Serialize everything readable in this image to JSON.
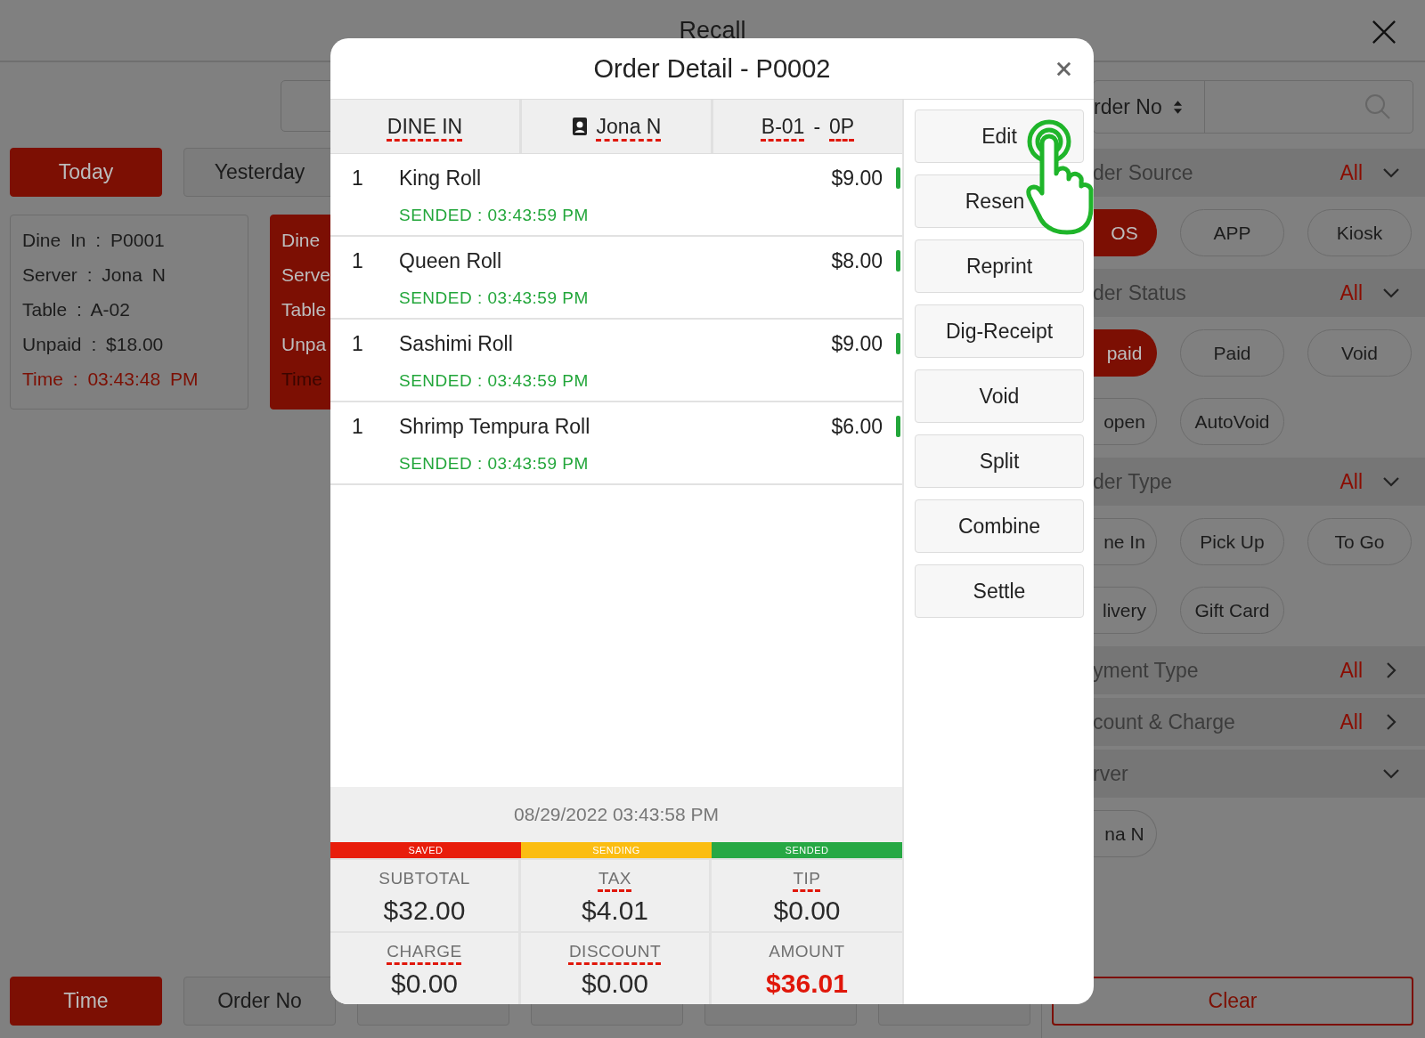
{
  "header": {
    "title": "Recall"
  },
  "date_filters": [
    {
      "label": "Today",
      "selected": true
    },
    {
      "label": "Yesterday",
      "selected": false
    }
  ],
  "orders": [
    {
      "selected": false,
      "lines": [
        {
          "text": "Dine In : P0001",
          "highlight": false
        },
        {
          "text": "Server : Jona N",
          "highlight": false
        },
        {
          "text": "Table : A-02",
          "highlight": false
        },
        {
          "text": "Unpaid : $18.00",
          "highlight": false
        },
        {
          "text": "Time : 03:43:48 PM",
          "highlight": true
        }
      ]
    },
    {
      "selected": true,
      "lines": [
        {
          "text": "Dine",
          "highlight": false
        },
        {
          "text": "Serve",
          "highlight": false
        },
        {
          "text": "Table",
          "highlight": false
        },
        {
          "text": "Unpa",
          "highlight": false
        },
        {
          "text": "Time",
          "highlight": true
        }
      ]
    }
  ],
  "sort_buttons": [
    {
      "label": "Time",
      "selected": true
    },
    {
      "label": "Order No",
      "selected": false
    },
    {
      "selected": false
    },
    {
      "selected": false
    },
    {
      "selected": false
    },
    {
      "selected": false
    }
  ],
  "search": {
    "sort_label": "rder No"
  },
  "filters": [
    {
      "title": "der Source",
      "value": "All",
      "kind": "dropdown",
      "chips": [
        {
          "label": "OS",
          "selected": true
        },
        {
          "label": "APP",
          "selected": false
        },
        {
          "label": "Kiosk",
          "selected": false
        }
      ]
    },
    {
      "title": "der Status",
      "value": "All",
      "kind": "dropdown",
      "chips": [
        {
          "label": "paid",
          "selected": true
        },
        {
          "label": "Paid",
          "selected": false
        },
        {
          "label": "Void",
          "selected": false
        },
        {
          "label": "open",
          "selected": false
        },
        {
          "label": "AutoVoid",
          "selected": false
        }
      ]
    },
    {
      "title": "der Type",
      "value": "All",
      "kind": "dropdown",
      "chips": [
        {
          "label": "ne In",
          "selected": false
        },
        {
          "label": "Pick Up",
          "selected": false
        },
        {
          "label": "To Go",
          "selected": false
        },
        {
          "label": "livery",
          "selected": false
        },
        {
          "label": "Gift Card",
          "selected": false
        }
      ]
    },
    {
      "title": "yment Type",
      "value": "All",
      "kind": "link"
    },
    {
      "title": "count & Charge",
      "value": "All",
      "kind": "link"
    },
    {
      "title": "rver",
      "kind": "dropdown",
      "chips": [
        {
          "label": "na N",
          "selected": false
        }
      ]
    }
  ],
  "clear_button": "Clear",
  "dialog": {
    "title": "Order Detail - P0002",
    "header_cells": [
      {
        "kind": "order_type",
        "parts": [
          {
            "text": "DINE IN",
            "underlined": true
          }
        ]
      },
      {
        "kind": "server",
        "parts": [
          {
            "text": "Jona N",
            "underlined": true
          }
        ]
      },
      {
        "kind": "table",
        "parts": [
          {
            "text": "B-01",
            "underlined": true
          },
          {
            "text": "-",
            "underlined": false
          },
          {
            "text": "0P",
            "underlined": true
          }
        ]
      }
    ],
    "items": [
      {
        "qty": "1",
        "name": "King Roll",
        "price": "$9.00",
        "status": "SENDED : 03:43:59 PM",
        "color": "#22a63a"
      },
      {
        "qty": "1",
        "name": "Queen Roll",
        "price": "$8.00",
        "status": "SENDED : 03:43:59 PM",
        "color": "#22a63a"
      },
      {
        "qty": "1",
        "name": "Sashimi Roll",
        "price": "$9.00",
        "status": "SENDED : 03:43:59 PM",
        "color": "#22a63a"
      },
      {
        "qty": "1",
        "name": "Shrimp Tempura Roll",
        "price": "$6.00",
        "status": "SENDED : 03:43:59 PM",
        "color": "#22a63a"
      }
    ],
    "timestamp": "08/29/2022 03:43:58 PM",
    "legend": [
      {
        "label": "SAVED",
        "color": "#e81d0b"
      },
      {
        "label": "SENDING",
        "color": "#fbbd12"
      },
      {
        "label": "SENDED",
        "color": "#27a844"
      }
    ],
    "totals": [
      {
        "label": "SUBTOTAL",
        "value": "$32.00",
        "underlined": false,
        "highlight": false
      },
      {
        "label": "TAX",
        "value": "$4.01",
        "underlined": true,
        "highlight": false
      },
      {
        "label": "TIP",
        "value": "$0.00",
        "underlined": true,
        "highlight": false
      },
      {
        "label": "CHARGE",
        "value": "$0.00",
        "underlined": true,
        "highlight": false
      },
      {
        "label": "DISCOUNT",
        "value": "$0.00",
        "underlined": true,
        "highlight": false
      },
      {
        "label": "AMOUNT",
        "value": "$36.01",
        "underlined": false,
        "highlight": true
      }
    ],
    "actions": [
      "Edit",
      "Resen",
      "Reprint",
      "Dig-Receipt",
      "Void",
      "Split",
      "Combine",
      "Settle"
    ]
  }
}
